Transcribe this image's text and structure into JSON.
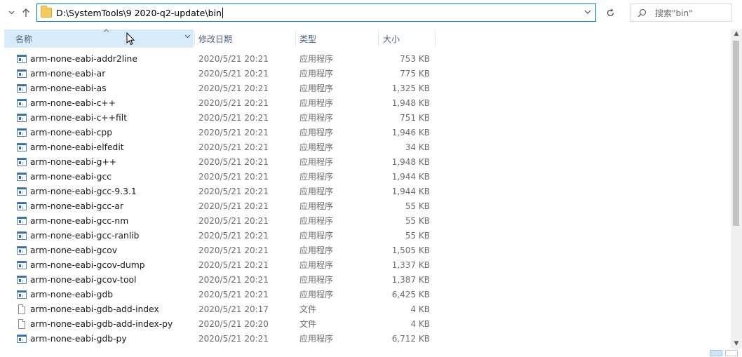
{
  "address": {
    "path": "D:\\SystemTools\\9 2020-q2-update\\bin"
  },
  "search": {
    "placeholder": "搜索\"bin\""
  },
  "columns": {
    "name": "名称",
    "date": "修改日期",
    "type": "类型",
    "size": "大小"
  },
  "files": [
    {
      "name": "arm-none-eabi-addr2line",
      "date": "2020/5/21 20:21",
      "type": "应用程序",
      "size": "753 KB",
      "icon": "exe-icon"
    },
    {
      "name": "arm-none-eabi-ar",
      "date": "2020/5/21 20:21",
      "type": "应用程序",
      "size": "775 KB",
      "icon": "exe-icon"
    },
    {
      "name": "arm-none-eabi-as",
      "date": "2020/5/21 20:21",
      "type": "应用程序",
      "size": "1,325 KB",
      "icon": "exe-icon"
    },
    {
      "name": "arm-none-eabi-c++",
      "date": "2020/5/21 20:21",
      "type": "应用程序",
      "size": "1,948 KB",
      "icon": "exe-icon"
    },
    {
      "name": "arm-none-eabi-c++filt",
      "date": "2020/5/21 20:21",
      "type": "应用程序",
      "size": "751 KB",
      "icon": "exe-icon"
    },
    {
      "name": "arm-none-eabi-cpp",
      "date": "2020/5/21 20:21",
      "type": "应用程序",
      "size": "1,946 KB",
      "icon": "exe-icon"
    },
    {
      "name": "arm-none-eabi-elfedit",
      "date": "2020/5/21 20:21",
      "type": "应用程序",
      "size": "34 KB",
      "icon": "exe-icon"
    },
    {
      "name": "arm-none-eabi-g++",
      "date": "2020/5/21 20:21",
      "type": "应用程序",
      "size": "1,948 KB",
      "icon": "exe-icon"
    },
    {
      "name": "arm-none-eabi-gcc",
      "date": "2020/5/21 20:21",
      "type": "应用程序",
      "size": "1,944 KB",
      "icon": "exe-icon"
    },
    {
      "name": "arm-none-eabi-gcc-9.3.1",
      "date": "2020/5/21 20:21",
      "type": "应用程序",
      "size": "1,944 KB",
      "icon": "exe-icon"
    },
    {
      "name": "arm-none-eabi-gcc-ar",
      "date": "2020/5/21 20:21",
      "type": "应用程序",
      "size": "55 KB",
      "icon": "exe-icon"
    },
    {
      "name": "arm-none-eabi-gcc-nm",
      "date": "2020/5/21 20:21",
      "type": "应用程序",
      "size": "55 KB",
      "icon": "exe-icon"
    },
    {
      "name": "arm-none-eabi-gcc-ranlib",
      "date": "2020/5/21 20:21",
      "type": "应用程序",
      "size": "55 KB",
      "icon": "exe-icon"
    },
    {
      "name": "arm-none-eabi-gcov",
      "date": "2020/5/21 20:21",
      "type": "应用程序",
      "size": "1,505 KB",
      "icon": "exe-icon"
    },
    {
      "name": "arm-none-eabi-gcov-dump",
      "date": "2020/5/21 20:21",
      "type": "应用程序",
      "size": "1,337 KB",
      "icon": "exe-icon"
    },
    {
      "name": "arm-none-eabi-gcov-tool",
      "date": "2020/5/21 20:21",
      "type": "应用程序",
      "size": "1,387 KB",
      "icon": "exe-icon"
    },
    {
      "name": "arm-none-eabi-gdb",
      "date": "2020/5/21 20:21",
      "type": "应用程序",
      "size": "6,425 KB",
      "icon": "exe-icon"
    },
    {
      "name": "arm-none-eabi-gdb-add-index",
      "date": "2020/5/21 20:17",
      "type": "文件",
      "size": "4 KB",
      "icon": "file-icon"
    },
    {
      "name": "arm-none-eabi-gdb-add-index-py",
      "date": "2020/5/21 20:20",
      "type": "文件",
      "size": "4 KB",
      "icon": "file-icon"
    },
    {
      "name": "arm-none-eabi-gdb-py",
      "date": "2020/5/21 20:21",
      "type": "应用程序",
      "size": "6,712 KB",
      "icon": "exe-icon"
    }
  ]
}
